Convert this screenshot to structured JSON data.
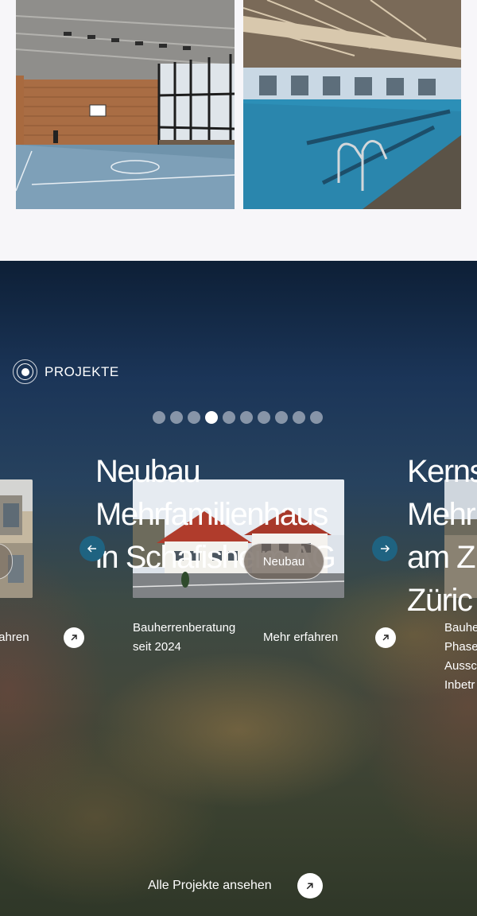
{
  "gallery": {
    "images": [
      {
        "name": "turnhalle"
      },
      {
        "name": "hallenbad"
      }
    ]
  },
  "projects": {
    "section_label": "PROJEKTE",
    "slide_count": 10,
    "active_slide": 4,
    "prev_label": "",
    "next_label": "",
    "all_projects": "Alle Projekte ansehen",
    "slides": {
      "left": {
        "more": "fahren"
      },
      "main": {
        "title_lines": [
          "Neubau",
          "Mehrfamilienhaus",
          "in Schafisheim AG"
        ],
        "badge": "Neubau",
        "desc_lines": [
          "Bauherrenberatung",
          "seit 2024"
        ],
        "more": "Mehr erfahren"
      },
      "right": {
        "title_lines": [
          "Kerns",
          "Mehr",
          "am Z",
          "Züric"
        ],
        "desc_lines": [
          "Bauhe",
          "Phase",
          "Aussc",
          "Inbetr"
        ]
      }
    }
  },
  "colors": {
    "accent": "#1f6381",
    "bg_light": "#f7f6f9"
  }
}
